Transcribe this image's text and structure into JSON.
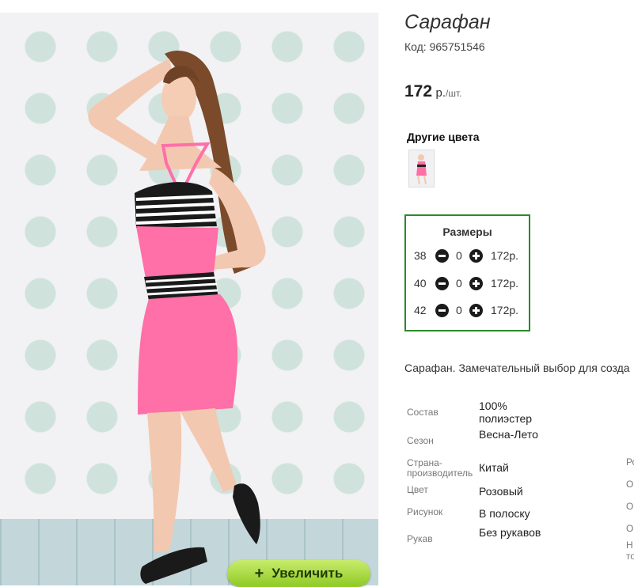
{
  "product": {
    "title": "Сарафан",
    "code": "Код: 965751546",
    "price": {
      "amount": "172",
      "currency": "р.",
      "per_unit": "/шт."
    }
  },
  "zoom_button": {
    "icon": "plus-icon",
    "label": "Увеличить"
  },
  "other_colors": {
    "heading": "Другие цвета",
    "swatches": [
      {
        "color": "#ff6fa8"
      }
    ]
  },
  "sizes": {
    "heading": "Размеры",
    "rows": [
      {
        "size": "38",
        "qty": "0",
        "price": "172р."
      },
      {
        "size": "40",
        "qty": "0",
        "price": "172р."
      },
      {
        "size": "42",
        "qty": "0",
        "price": "172р."
      }
    ]
  },
  "description": "Сарафан. Замечательный выбор для созда",
  "properties": [
    {
      "name": "Состав",
      "value": "100% полиэстер"
    },
    {
      "name": "Сезон",
      "value": "Весна-Лето"
    },
    {
      "name": "Страна-производитель",
      "value": "Китай"
    },
    {
      "name": "Цвет",
      "value": "Розовый"
    },
    {
      "name": "Рисунок",
      "value": "В полоску"
    },
    {
      "name": "Рукав",
      "value": "Без рукавов"
    }
  ],
  "truncated_column": [
    "Ро",
    "О",
    "О",
    "О",
    "Н",
    "то"
  ],
  "colors": {
    "accent_green": "#2a8a2a",
    "dress_pink": "#ff6fa8",
    "button_green": "#9bd22f",
    "polka_dot": "#cfe3dc"
  }
}
